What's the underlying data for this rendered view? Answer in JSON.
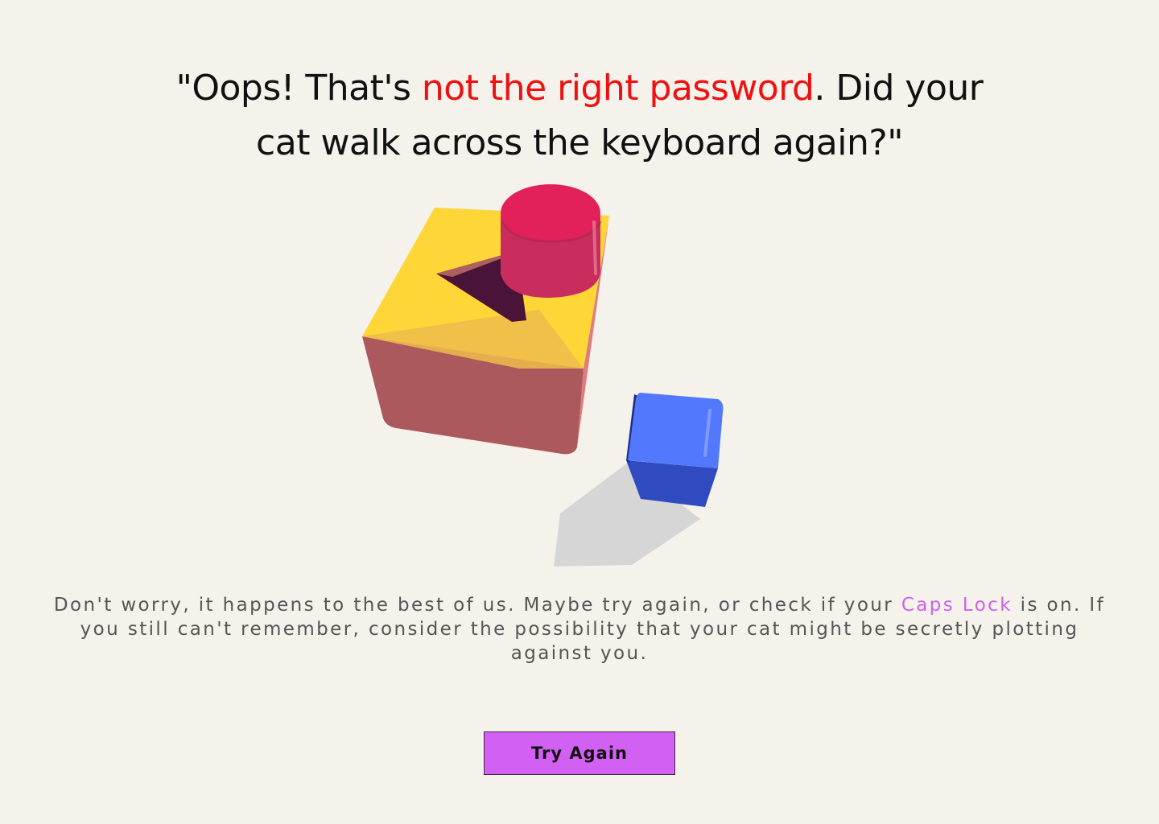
{
  "headline": {
    "before": "\"Oops! That's ",
    "accent": "not the right password",
    "after": ". Did your cat walk across the keyboard again?\""
  },
  "message": {
    "before": "Don't worry, it happens to the best of us. Maybe try again, or check if your ",
    "highlight": "Caps Lock",
    "after": " is on. If you still can't remember, consider the possibility that your cat might be secretly plotting against you."
  },
  "actions": {
    "try_again_label": "Try Again"
  },
  "colors": {
    "background": "#f5f1eb",
    "accent_red": "#ee1111",
    "highlight_purple": "#cf61ec",
    "button": "#d160f3"
  },
  "illustration": {
    "icon": "shape-sorter-illustration"
  }
}
